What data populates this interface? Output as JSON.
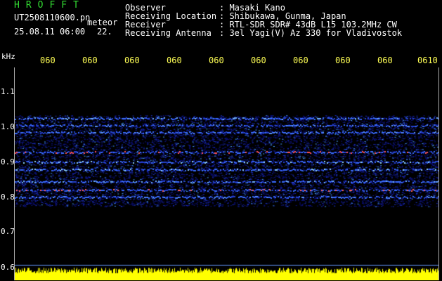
{
  "header": {
    "app_title": "HROFFT",
    "filename": "UT2508110600.pn",
    "mode": "meteor",
    "datetime": "25.08.11 06:00",
    "value": "22."
  },
  "info": {
    "rows": [
      {
        "label": "Observer",
        "value": ": Masaki Kano"
      },
      {
        "label": "Receiving Location",
        "value": ": Shibukawa, Gunma, Japan"
      },
      {
        "label": "Receiver",
        "value": ": RTL-SDR SDR# 43dB L15 103.2MHz CW"
      },
      {
        "label": "Receiving Antenna",
        "value": ": 3el Yagi(V) Az 330 for Vladivostok"
      }
    ]
  },
  "axis": {
    "unit_label": "kHz",
    "time_ticks": [
      "060",
      "060",
      "060",
      "060",
      "060",
      "060",
      "060",
      "060",
      "060",
      "0610"
    ],
    "freq_ticks": [
      "1.1",
      "1.0",
      "0.9",
      "0.8",
      "0.7",
      "0.6"
    ]
  },
  "colors": {
    "background": "#000000",
    "title_green": "#33dd33",
    "tick_yellow": "#ffff55",
    "signal_bars": "#ffff00",
    "spectrum_low": "#0a0a7a",
    "spectrum_mid": "#3a6cff",
    "spectrum_high": "#ff3030"
  }
}
